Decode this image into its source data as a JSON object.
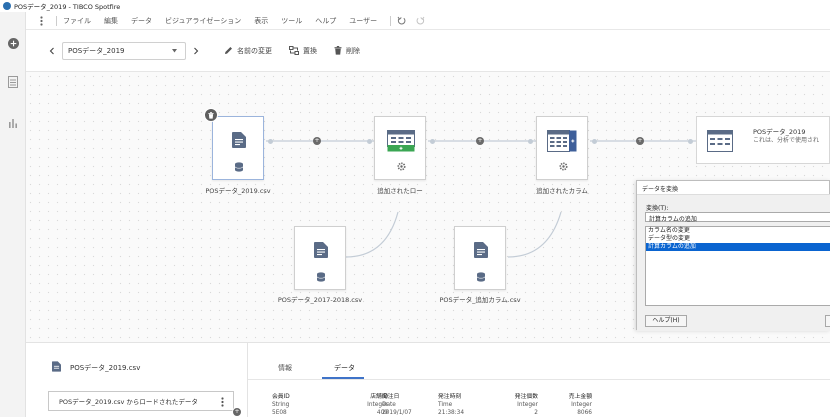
{
  "window": {
    "title": "POSデータ_2019 - TIBCO Spotfire"
  },
  "menu": {
    "items": [
      "ファイル",
      "編集",
      "データ",
      "ビジュアライゼーション",
      "表示",
      "ツール",
      "ヘルプ",
      "ユーザー"
    ]
  },
  "toolbar": {
    "dataset": "POSデータ_2019",
    "rename": "名前の変更",
    "replace": "置換",
    "delete": "削除"
  },
  "canvas": {
    "nodes": {
      "source_2019": "POSデータ_2019.csv",
      "added_rows": "追加されたロー",
      "added_columns": "追加されたカラム",
      "source_2017": "POSデータ_2017-2018.csv",
      "source_addcol": "POSデータ_追加カラム.csv"
    },
    "summary": {
      "title": "POSデータ_2019",
      "desc": "これは、分析で使用され"
    }
  },
  "dialog": {
    "title": "データを変換",
    "transform_label": "変換(T):",
    "selected": "計算カラムの追加",
    "options": [
      "カラム名の変更",
      "データ型の変更",
      "計算カラムの追加"
    ],
    "help": "ヘルプ(H)"
  },
  "bottom_left": {
    "title": "POSデータ_2019.csv",
    "source": "POSデータ_2019.csv からロードされたデータ"
  },
  "bottom_right": {
    "tabs": [
      "情報",
      "データ"
    ],
    "columns": [
      {
        "name": "会員ID",
        "type": "String",
        "row": "5E08"
      },
      {
        "name": "店舗ID",
        "type": "Integer",
        "row": "409"
      },
      {
        "name": "発注日",
        "type": "Date",
        "row": "2019/1/07"
      },
      {
        "name": "発注時刻",
        "type": "Time",
        "row": "21:38:34"
      },
      {
        "name": "発注個数",
        "type": "Integer",
        "row": "2"
      },
      {
        "name": "売上金額",
        "type": "Integer",
        "row": "8066"
      }
    ]
  },
  "colors": {
    "accent": "#3f73c8",
    "node_icon": "#5a6b86",
    "add_green": "#3aa653",
    "dialog_selection": "#0a64d0"
  }
}
